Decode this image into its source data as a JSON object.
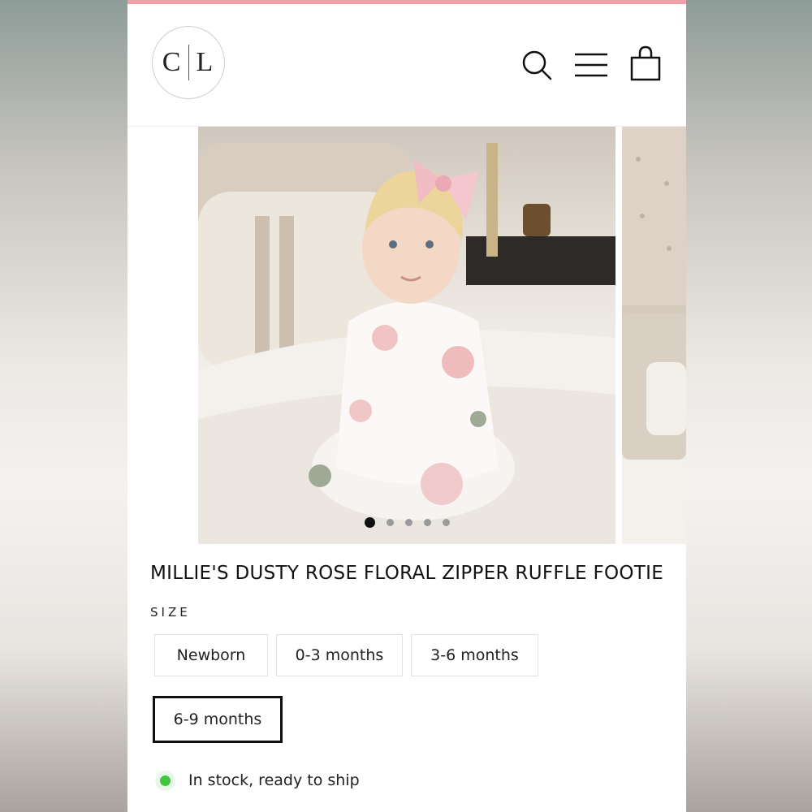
{
  "header": {
    "logo_left": "C",
    "logo_right": "L",
    "icons": [
      "search-icon",
      "menu-icon",
      "cart-icon"
    ]
  },
  "gallery": {
    "slide_count": 5,
    "active_index": 0
  },
  "product": {
    "title": "MILLIE'S DUSTY ROSE FLORAL ZIPPER RUFFLE FOOTIE",
    "size_label": "SIZE",
    "sizes": [
      "Newborn",
      "0-3 months",
      "3-6 months",
      "6-9 months"
    ],
    "selected_size": "6-9 months",
    "stock_text": "In stock, ready to ship"
  },
  "colors": {
    "accent_bar": "#f1a1a5",
    "stock_dot": "#3fc63f"
  }
}
